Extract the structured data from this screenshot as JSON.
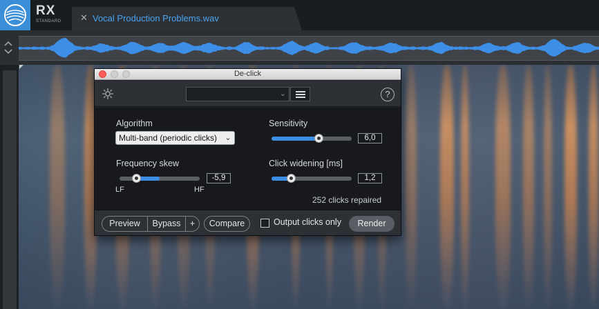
{
  "app": {
    "name": "RX",
    "edition": "STANDARD"
  },
  "tab": {
    "close_glyph": "✕",
    "title": "Vocal Production Problems.wav"
  },
  "overview": {
    "arrows_glyph": "⌃⌄",
    "waveform_color": "#3d8ee6"
  },
  "dialog": {
    "title": "De-click",
    "header": {
      "preset_value": "",
      "help_glyph": "?"
    },
    "algorithm": {
      "label": "Algorithm",
      "value": "Multi-band (periodic clicks)"
    },
    "sensitivity": {
      "label": "Sensitivity",
      "value": "6,0",
      "fraction": 0.59
    },
    "frequency_skew": {
      "label": "Frequency skew",
      "value": "-5,9",
      "fraction": 0.21,
      "fill_to": 0.5,
      "low_label": "LF",
      "high_label": "HF"
    },
    "click_widening": {
      "label": "Click widening [ms]",
      "value": "1,2",
      "fraction": 0.24
    },
    "status": "252 clicks repaired",
    "footer": {
      "preview": "Preview",
      "bypass": "Bypass",
      "plus": "+",
      "compare": "Compare",
      "output_clicks_only": "Output clicks only",
      "output_clicks_checked": false,
      "render": "Render"
    }
  },
  "colors": {
    "accent": "#3d8ee6",
    "logo_bg": "#3b8ed8",
    "tab_title": "#4aa3f0"
  }
}
